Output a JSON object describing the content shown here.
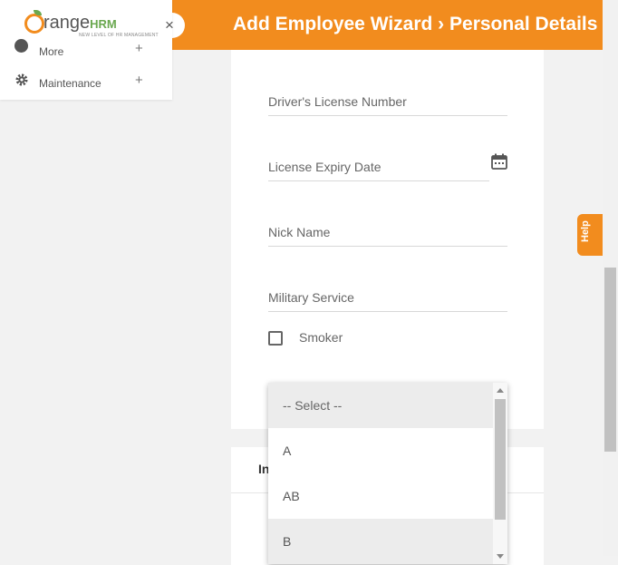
{
  "header": {
    "title": "Add Employee Wizard › Personal Details",
    "color": "#f28c1e"
  },
  "sidebar": {
    "logo": {
      "brand_main": "range",
      "brand_suffix": "HRM",
      "tagline": "NEW LEVEL OF HR MANAGEMENT"
    },
    "close_symbol": "×",
    "items": [
      {
        "label": "More",
        "icon": "more-icon",
        "expand_symbol": "+"
      },
      {
        "label": "Maintenance",
        "icon": "gear-icon",
        "expand_symbol": "+"
      }
    ]
  },
  "form": {
    "fields": {
      "license_number": {
        "placeholder": "Driver's License Number",
        "value": ""
      },
      "license_expiry": {
        "placeholder": "License Expiry Date",
        "value": "",
        "icon": "calendar-icon"
      },
      "nick_name": {
        "placeholder": "Nick Name",
        "value": ""
      },
      "military_service": {
        "placeholder": "Military Service",
        "value": ""
      }
    },
    "smoker": {
      "label": "Smoker",
      "checked": false
    },
    "blood_group_dropdown": {
      "options": [
        "-- Select --",
        "A",
        "AB",
        "B"
      ],
      "highlighted": "B"
    }
  },
  "second_card": {
    "title_fragment": "In"
  },
  "help": {
    "label": "Help"
  }
}
